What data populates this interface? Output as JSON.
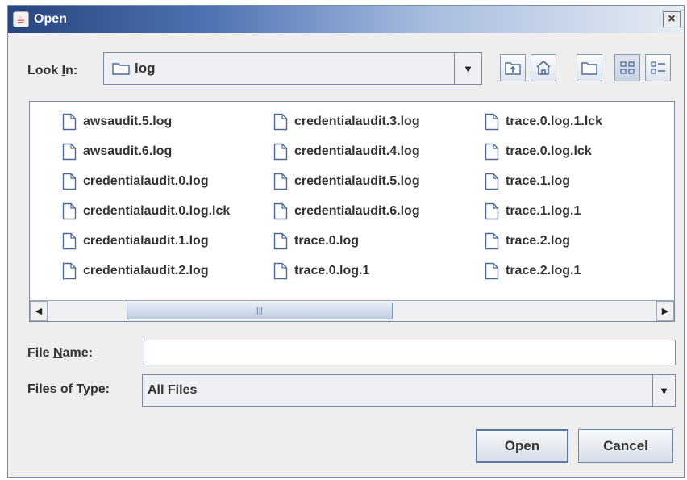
{
  "dialog": {
    "title": "Open",
    "close_label": "×"
  },
  "look_in": {
    "label_pre": "Look ",
    "label_mnemonic": "I",
    "label_post": "n:",
    "value": "log"
  },
  "toolbar": {
    "icons": [
      "up-one-level-icon",
      "home-icon",
      "new-folder-icon",
      "list-view-icon",
      "details-view-icon"
    ]
  },
  "files": [
    "awsaudit.5.log",
    "awsaudit.6.log",
    "credentialaudit.0.log",
    "credentialaudit.0.log.lck",
    "credentialaudit.1.log",
    "credentialaudit.2.log",
    "credentialaudit.3.log",
    "credentialaudit.4.log",
    "credentialaudit.5.log",
    "credentialaudit.6.log",
    "trace.0.log",
    "trace.0.log.1",
    "trace.0.log.1.lck",
    "trace.0.log.lck",
    "trace.1.log",
    "trace.1.log.1",
    "trace.2.log",
    "trace.2.log.1"
  ],
  "scrollbar": {
    "left_arrow": "◀",
    "right_arrow": "▶",
    "thumb_grip": "|||"
  },
  "file_name": {
    "label_pre": "File ",
    "label_mnemonic": "N",
    "label_post": "ame:",
    "value": "",
    "placeholder": ""
  },
  "file_type": {
    "label_pre": "Files of ",
    "label_mnemonic": "T",
    "label_post": "ype:",
    "value": "All Files"
  },
  "combo_arrow": "▼",
  "buttons": {
    "open": "Open",
    "cancel": "Cancel"
  }
}
